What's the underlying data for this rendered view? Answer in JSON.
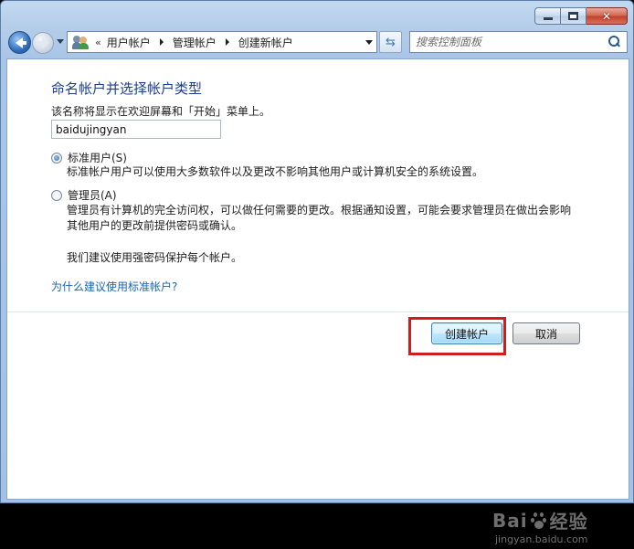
{
  "navigation": {
    "breadcrumb_overflow": "«",
    "breadcrumbs": [
      "用户帐户",
      "管理帐户",
      "创建新帐户"
    ]
  },
  "search": {
    "placeholder": "搜索控制面板"
  },
  "page": {
    "title": "命名帐户并选择帐户类型",
    "name_description": "该名称将显示在欢迎屏幕和「开始」菜单上。",
    "account_name_value": "baidujingyan",
    "options": [
      {
        "label": "标准用户(S)",
        "selected": true,
        "description": "标准帐户用户可以使用大多数软件以及更改不影响其他用户或计算机安全的系统设置。"
      },
      {
        "label": "管理员(A)",
        "selected": false,
        "description_line1": "管理员有计算机的完全访问权，可以做任何需要的更改。根据通知设置，可能会要求管理员在做出会影响",
        "description_line2": "其他用户的更改前提供密码或确认。",
        "recommendation": "我们建议使用强密码保护每个帐户。"
      }
    ],
    "help_link": "为什么建议使用标准帐户?"
  },
  "buttons": {
    "create": "创建帐户",
    "cancel": "取消"
  },
  "watermark": {
    "brand_left": "Bai",
    "brand_right": "经验",
    "url": "jingyan.baidu.com"
  },
  "icons": {
    "back": "back-arrow-icon",
    "forward": "forward-arrow-icon",
    "users": "users-icon",
    "refresh": "refresh-icon",
    "search": "search-icon"
  },
  "colors": {
    "title": "#1b3f93",
    "link": "#1b64b8",
    "highlight": "#d01c1c",
    "frame": "#a9c5e6"
  }
}
